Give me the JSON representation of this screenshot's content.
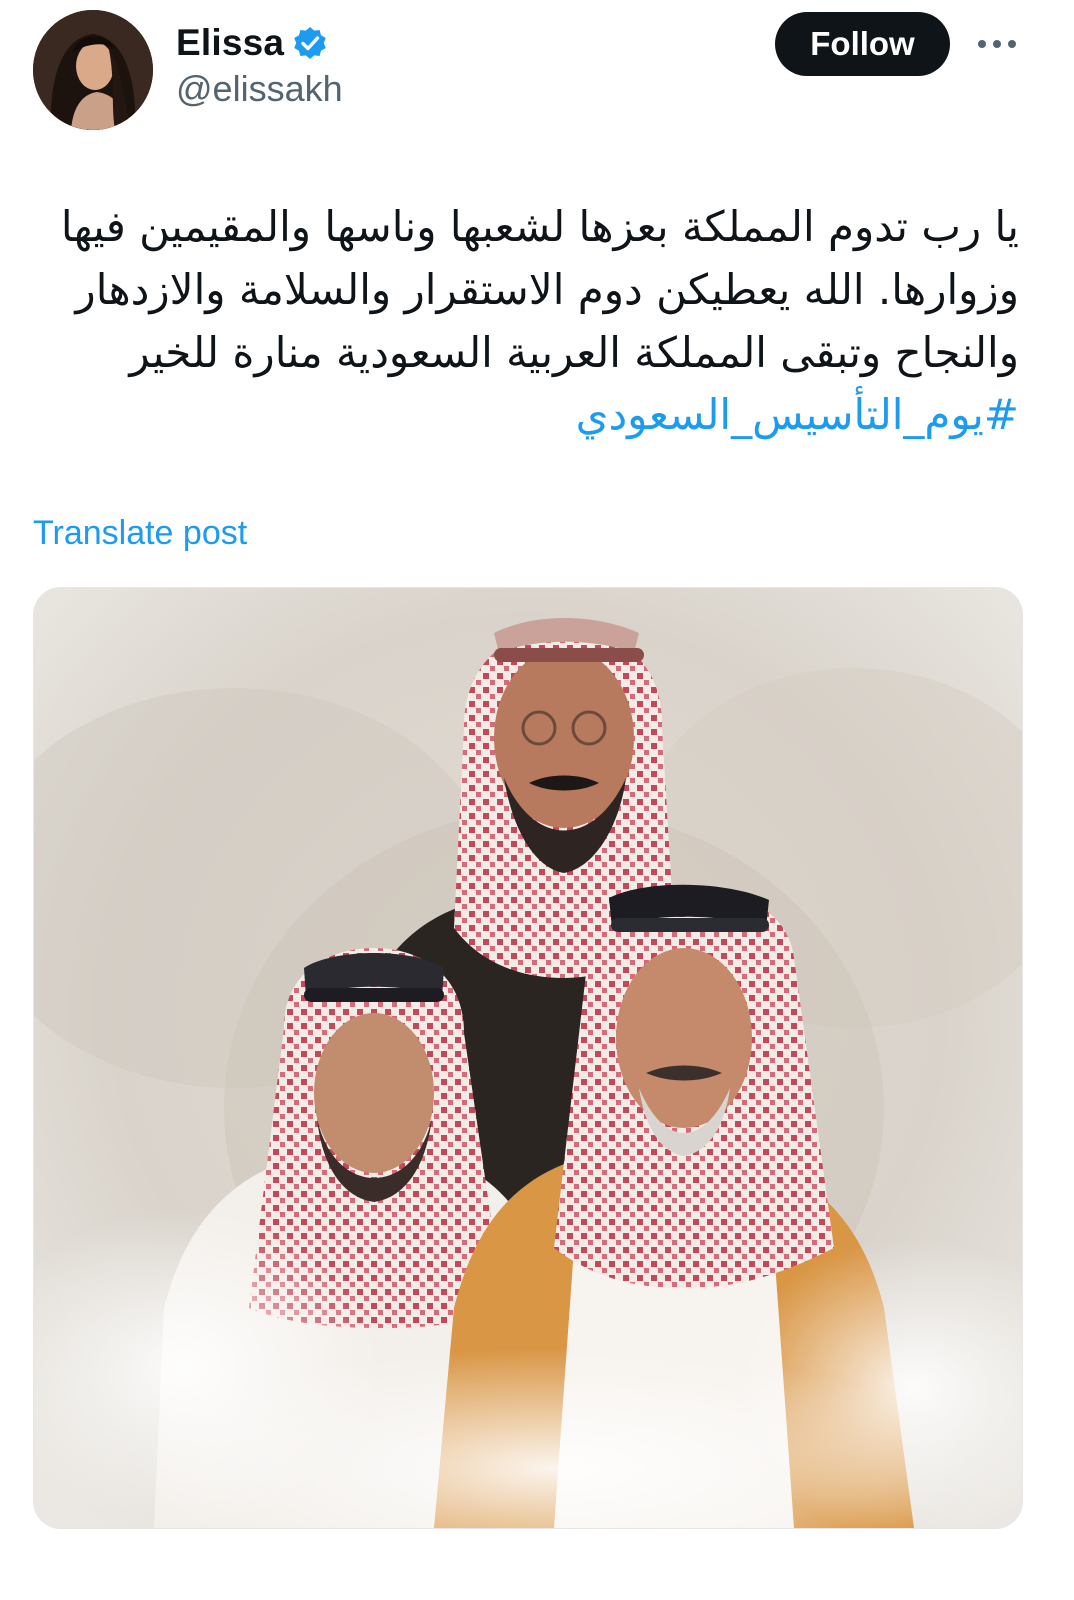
{
  "author": {
    "display_name": "Elissa",
    "handle": "@elissakh",
    "verified": true,
    "avatar_icon": "profile-photo"
  },
  "actions": {
    "follow_label": "Follow",
    "more_icon": "more-horizontal-icon"
  },
  "post": {
    "lines": [
      "يا رب تدوم المملكة بعزها لشعبها وناسها والمقيمين فيها",
      "وزوارها. الله يعطيكن دوم الاستقرار والسلامة والازدهار",
      "والنجاح وتبقى المملكة العربية السعودية منارة للخير"
    ],
    "hashtag": "#يوم_التأسيس_السعودي",
    "translate_label": "Translate post"
  },
  "media": {
    "type": "image",
    "description_icon": "watercolor-portrait-illustration"
  },
  "colors": {
    "link": "#1d9bf0",
    "text": "#0f1419",
    "secondary_text": "#536471",
    "follow_bg": "#0f1419",
    "verified_badge": "#1d9bf0"
  }
}
